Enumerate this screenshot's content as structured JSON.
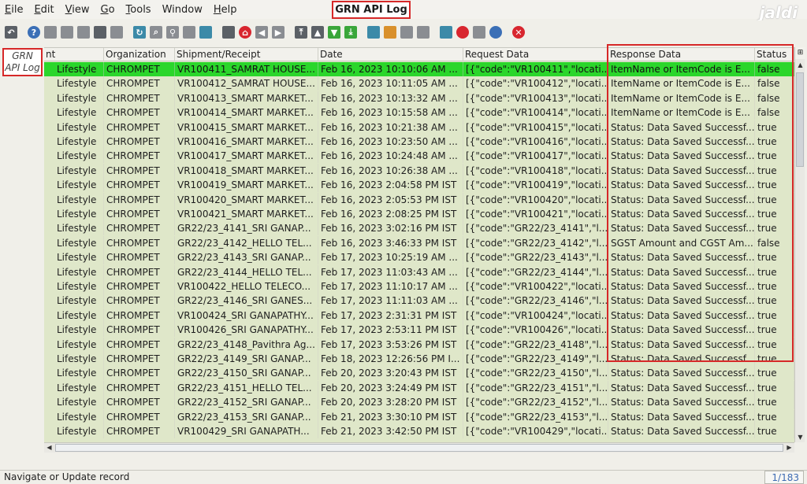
{
  "window": {
    "title": "GRN API Log",
    "brand": "jaldi"
  },
  "menu": [
    {
      "key": "E",
      "rest": "ile",
      "label": "File"
    },
    {
      "key": "E",
      "rest": "dit",
      "label": "Edit"
    },
    {
      "key": "V",
      "rest": "iew",
      "label": "View"
    },
    {
      "key": "G",
      "rest": "o",
      "label": "Go"
    },
    {
      "key": "T",
      "rest": "ools",
      "label": "Tools"
    },
    {
      "key": "",
      "rest": "Window",
      "label": "Window"
    },
    {
      "key": "H",
      "rest": "elp",
      "label": "Help"
    }
  ],
  "toolbar": [
    "undo-icon",
    "help-icon",
    "new-icon",
    "copy-icon",
    "delete-icon",
    "tools-icon",
    "save-icon",
    "refresh-icon",
    "find-icon",
    "attach-icon",
    "chat-icon",
    "zoom-fit-icon",
    "history-icon",
    "home-icon",
    "back-icon",
    "forward-icon",
    "first-icon",
    "up-icon",
    "down-icon",
    "last-icon",
    "report-icon",
    "archive-icon",
    "print-icon",
    "print-preview-icon",
    "zoom-icon",
    "workflow-icon",
    "product-icon",
    "save-disk-icon",
    "close-icon"
  ],
  "left_tab": {
    "label": "GRN API Log"
  },
  "grid": {
    "columns": [
      "nt",
      "Organization",
      "Shipment/Receipt",
      "Date",
      "Request Data",
      "Response Data",
      "Status"
    ],
    "rows": [
      [
        "Lifestyle",
        "CHROMPET",
        "VR100411_SAMRAT HOUSE...",
        "Feb 16, 2023 10:10:06 AM ...",
        "[{\"code\":\"VR100411\",\"locati...",
        "ItemName or ItemCode is E...",
        "false"
      ],
      [
        "Lifestyle",
        "CHROMPET",
        "VR100412_SAMRAT HOUSE...",
        "Feb 16, 2023 10:11:05 AM ...",
        "[{\"code\":\"VR100412\",\"locati...",
        "ItemName or ItemCode is E...",
        "false"
      ],
      [
        "Lifestyle",
        "CHROMPET",
        "VR100413_SMART MARKET...",
        "Feb 16, 2023 10:13:32 AM ...",
        "[{\"code\":\"VR100413\",\"locati...",
        "ItemName or ItemCode is E...",
        "false"
      ],
      [
        "Lifestyle",
        "CHROMPET",
        "VR100414_SMART MARKET...",
        "Feb 16, 2023 10:15:58 AM ...",
        "[{\"code\":\"VR100414\",\"locati...",
        "ItemName or ItemCode is E...",
        "false"
      ],
      [
        "Lifestyle",
        "CHROMPET",
        "VR100415_SMART MARKET...",
        "Feb 16, 2023 10:21:38 AM ...",
        "[{\"code\":\"VR100415\",\"locati...",
        "Status: Data Saved Successf...",
        "true"
      ],
      [
        "Lifestyle",
        "CHROMPET",
        "VR100416_SMART MARKET...",
        "Feb 16, 2023 10:23:50 AM ...",
        "[{\"code\":\"VR100416\",\"locati...",
        "Status: Data Saved Successf...",
        "true"
      ],
      [
        "Lifestyle",
        "CHROMPET",
        "VR100417_SMART MARKET...",
        "Feb 16, 2023 10:24:48 AM ...",
        "[{\"code\":\"VR100417\",\"locati...",
        "Status: Data Saved Successf...",
        "true"
      ],
      [
        "Lifestyle",
        "CHROMPET",
        "VR100418_SMART MARKET...",
        "Feb 16, 2023 10:26:38 AM ...",
        "[{\"code\":\"VR100418\",\"locati...",
        "Status: Data Saved Successf...",
        "true"
      ],
      [
        "Lifestyle",
        "CHROMPET",
        "VR100419_SMART MARKET...",
        "Feb 16, 2023 2:04:58 PM IST",
        "[{\"code\":\"VR100419\",\"locati...",
        "Status: Data Saved Successf...",
        "true"
      ],
      [
        "Lifestyle",
        "CHROMPET",
        "VR100420_SMART MARKET...",
        "Feb 16, 2023 2:05:53 PM IST",
        "[{\"code\":\"VR100420\",\"locati...",
        "Status: Data Saved Successf...",
        "true"
      ],
      [
        "Lifestyle",
        "CHROMPET",
        "VR100421_SMART MARKET...",
        "Feb 16, 2023 2:08:25 PM IST",
        "[{\"code\":\"VR100421\",\"locati...",
        "Status: Data Saved Successf...",
        "true"
      ],
      [
        "Lifestyle",
        "CHROMPET",
        "GR22/23_4141_SRI GANAP...",
        "Feb 16, 2023 3:02:16 PM IST",
        "[{\"code\":\"GR22/23_4141\",\"l...",
        "Status: Data Saved Successf...",
        "true"
      ],
      [
        "Lifestyle",
        "CHROMPET",
        "GR22/23_4142_HELLO TEL...",
        "Feb 16, 2023 3:46:33 PM IST",
        "[{\"code\":\"GR22/23_4142\",\"l...",
        "SGST Amount and CGST Am...",
        "false"
      ],
      [
        "Lifestyle",
        "CHROMPET",
        "GR22/23_4143_SRI GANAP...",
        "Feb 17, 2023 10:25:19 AM ...",
        "[{\"code\":\"GR22/23_4143\",\"l...",
        "Status: Data Saved Successf...",
        "true"
      ],
      [
        "Lifestyle",
        "CHROMPET",
        "GR22/23_4144_HELLO TEL...",
        "Feb 17, 2023 11:03:43 AM ...",
        "[{\"code\":\"GR22/23_4144\",\"l...",
        "Status: Data Saved Successf...",
        "true"
      ],
      [
        "Lifestyle",
        "CHROMPET",
        "VR100422_HELLO TELECO...",
        "Feb 17, 2023 11:10:17 AM ...",
        "[{\"code\":\"VR100422\",\"locati...",
        "Status: Data Saved Successf...",
        "true"
      ],
      [
        "Lifestyle",
        "CHROMPET",
        "GR22/23_4146_SRI GANES...",
        "Feb 17, 2023 11:11:03 AM ...",
        "[{\"code\":\"GR22/23_4146\",\"l...",
        "Status: Data Saved Successf...",
        "true"
      ],
      [
        "Lifestyle",
        "CHROMPET",
        "VR100424_SRI GANAPATHY...",
        "Feb 17, 2023 2:31:31 PM IST",
        "[{\"code\":\"VR100424\",\"locati...",
        "Status: Data Saved Successf...",
        "true"
      ],
      [
        "Lifestyle",
        "CHROMPET",
        "VR100426_SRI GANAPATHY...",
        "Feb 17, 2023 2:53:11 PM IST",
        "[{\"code\":\"VR100426\",\"locati...",
        "Status: Data Saved Successf...",
        "true"
      ],
      [
        "Lifestyle",
        "CHROMPET",
        "GR22/23_4148_Pavithra Ag...",
        "Feb 17, 2023 3:53:26 PM IST",
        "[{\"code\":\"GR22/23_4148\",\"l...",
        "Status: Data Saved Successf...",
        "true"
      ],
      [
        "Lifestyle",
        "CHROMPET",
        "GR22/23_4149_SRI GANAP...",
        "Feb 18, 2023 12:26:56 PM I...",
        "[{\"code\":\"GR22/23_4149\",\"l...",
        "Status: Data Saved Successf...",
        "true"
      ],
      [
        "Lifestyle",
        "CHROMPET",
        "GR22/23_4150_SRI GANAP...",
        "Feb 20, 2023 3:20:43 PM IST",
        "[{\"code\":\"GR22/23_4150\",\"l...",
        "Status: Data Saved Successf...",
        "true"
      ],
      [
        "Lifestyle",
        "CHROMPET",
        "GR22/23_4151_HELLO TEL...",
        "Feb 20, 2023 3:24:49 PM IST",
        "[{\"code\":\"GR22/23_4151\",\"l...",
        "Status: Data Saved Successf...",
        "true"
      ],
      [
        "Lifestyle",
        "CHROMPET",
        "GR22/23_4152_SRI GANAP...",
        "Feb 20, 2023 3:28:20 PM IST",
        "[{\"code\":\"GR22/23_4152\",\"l...",
        "Status: Data Saved Successf...",
        "true"
      ],
      [
        "Lifestyle",
        "CHROMPET",
        "GR22/23_4153_SRI GANAP...",
        "Feb 21, 2023 3:30:10 PM IST",
        "[{\"code\":\"GR22/23_4153\",\"l...",
        "Status: Data Saved Successf...",
        "true"
      ],
      [
        "Lifestyle",
        "CHROMPET",
        "VR100429_SRI GANAPATH...",
        "Feb 21, 2023 3:42:50 PM IST",
        "[{\"code\":\"VR100429\",\"locati...",
        "Status: Data Saved Successf...",
        "true"
      ]
    ],
    "selected_row": 0
  },
  "statusbar": {
    "message": "Navigate or Update record",
    "record": "1/183"
  },
  "colors": {
    "selected_row": "#2bd62b",
    "row_bg": "#dfe7c9",
    "highlight_border": "#d62828",
    "record_text": "#3d6bb3"
  }
}
